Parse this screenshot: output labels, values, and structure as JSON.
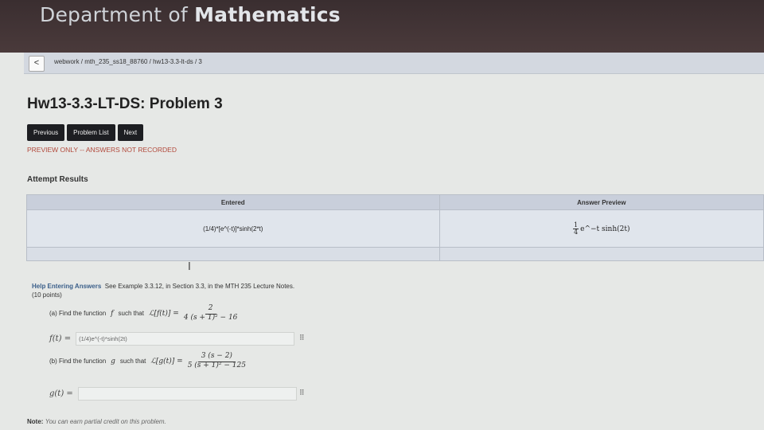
{
  "banner": {
    "title_prefix": "Department of ",
    "title_bold": "Mathematics"
  },
  "breadcrumb": {
    "back": "<",
    "path": "webwork / mth_235_ss18_88760 / hw13-3.3-lt-ds / 3"
  },
  "problem": {
    "title": "Hw13-3.3-LT-DS: Problem 3"
  },
  "nav": {
    "previous": "Previous",
    "list": "Problem List",
    "next": "Next"
  },
  "preview_notice": "PREVIEW ONLY -- ANSWERS NOT RECORDED",
  "attempt": {
    "label": "Attempt Results",
    "columns": [
      "Entered",
      "Answer Preview"
    ],
    "rows": [
      {
        "entered": "(1/4)*[e^(-t)]*sinh(2*t)",
        "preview_num": "1",
        "preview_den": "4",
        "preview_rest": "e^−t sinh(2t)"
      }
    ]
  },
  "cursor_glyph": "I",
  "help": {
    "link": "Help Entering Answers",
    "text": "See Example 3.3.12, in Section 3.3, in the MTH 235 Lecture Notes.",
    "points": "(10 points)"
  },
  "part_a": {
    "prompt": "(a) Find the function",
    "var": "f",
    "such": "such that",
    "lhs": "ℒ[f(t)] =",
    "num": "2",
    "den": "4 (s + 1)² − 16",
    "answer_label": "f(t) =",
    "answer_value": "(1/4)e^(-t)*sinh(2t)"
  },
  "part_b": {
    "prompt": "(b) Find the function",
    "var": "g",
    "such": "such that",
    "lhs": "ℒ[g(t)] =",
    "num": "3 (s − 2)",
    "den": "5 (s + 1)² − 125",
    "answer_label": "g(t) =",
    "answer_value": ""
  },
  "grid_icon": "⠿",
  "note": {
    "label": "Note:",
    "text": "You can earn partial credit on this problem."
  }
}
